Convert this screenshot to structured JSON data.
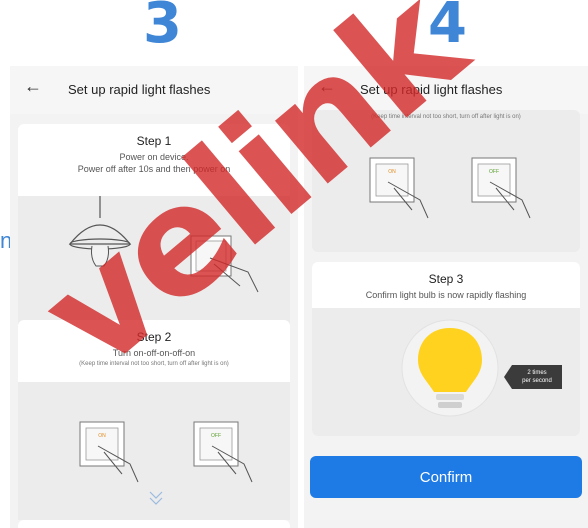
{
  "numbers": {
    "left": "3",
    "right": "4"
  },
  "side_fragment": "n",
  "screen_left": {
    "back_icon": "←",
    "title": "Set up rapid light flashes",
    "step1": {
      "title": "Step 1",
      "line1": "Power on device.",
      "line2": "Power off after 10s and then power on"
    },
    "step2": {
      "title": "Step 2",
      "line1": "Turn on-off-on-off-on",
      "note": "(Keep time interval not too short, turn off after light is on)"
    },
    "scroll_hint_icon": "chevron-down-icon",
    "switch_labels": {
      "on": "ON",
      "off": "OFF"
    }
  },
  "screen_right": {
    "back_icon": "←",
    "title": "Set up rapid light flashes",
    "note": "(Keep time interval not too short, turn off after light is on)",
    "step3": {
      "title": "Step 3",
      "line1": "Confirm light bulb is now rapidly flashing"
    },
    "badge": {
      "line1": "2 times",
      "line2": "per second"
    },
    "confirm_label": "Confirm",
    "switch_labels": {
      "on": "ON",
      "off": "OFF"
    }
  },
  "watermark": "velink",
  "colors": {
    "accent": "#3f86d6",
    "button": "#1e7be6",
    "bulb": "#ffd21f",
    "watermark": "#d22828"
  }
}
